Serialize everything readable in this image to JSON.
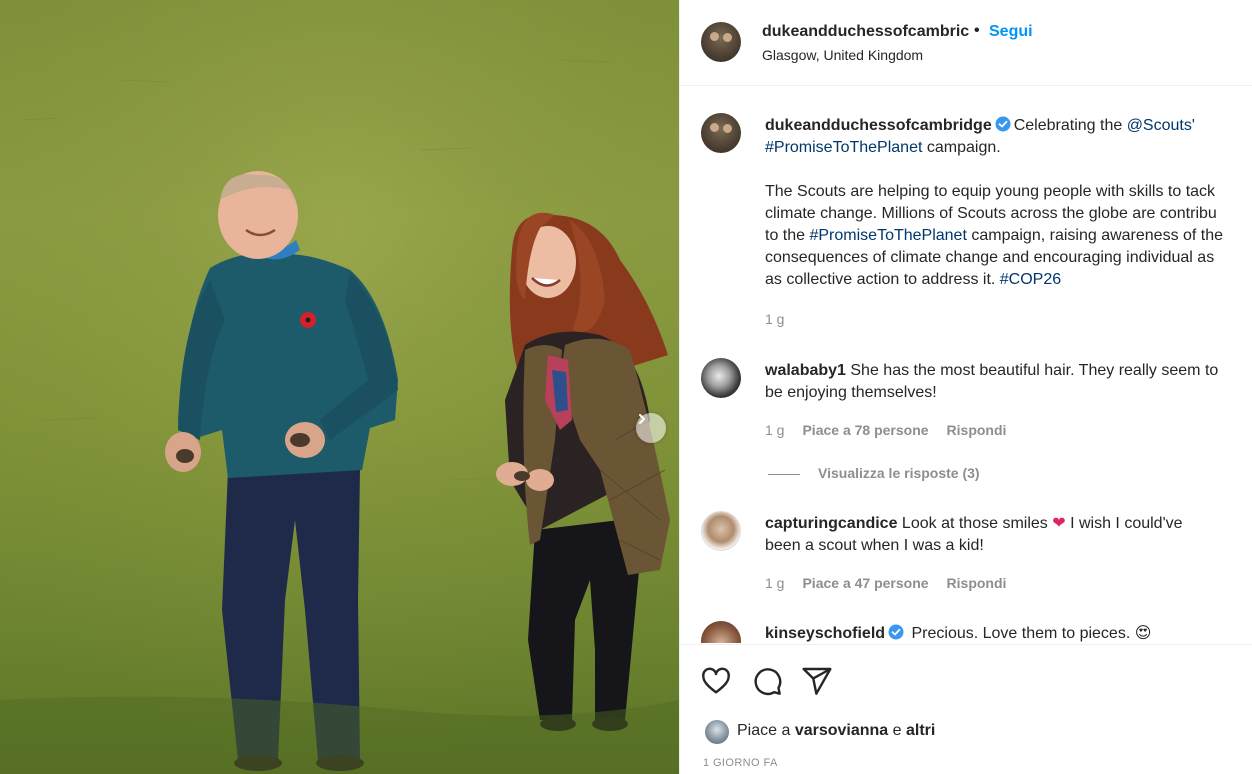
{
  "header": {
    "username": "dukeandduchessofcambric",
    "separator": "•",
    "follow_label": "Segui",
    "location": "Glasgow, United Kingdom"
  },
  "caption": {
    "username": "dukeandduchessofcambridge",
    "text_a": "Celebrating the ",
    "mention": "@Scouts'",
    "hashtag1": "#PromiseToThePlanet",
    "text_b": " campaign.",
    "para_line1": "The Scouts are helping to equip young people with skills to tack",
    "para_line2": "climate change. Millions of Scouts across the globe are contribu",
    "para_line3_a": "to the ",
    "para_line3_tag": "#PromiseToThePlanet",
    "para_line3_b": " campaign, raising awareness of the",
    "para_line4": "consequences of climate change and encouraging individual as",
    "para_line5_a": "as collective action to address it. ",
    "para_line5_tag": "#COP26",
    "time": "1 g"
  },
  "comments": [
    {
      "username": "walababy1",
      "line1": " She has the most beautiful hair. They really seem to",
      "line2": "be enjoying themselves!",
      "time": "1 g",
      "likes": "Piace a 78 persone",
      "reply": "Rispondi",
      "view_replies": "Visualizza le risposte (3)"
    },
    {
      "username": "capturingcandice",
      "line1_a": " Look at those smiles ",
      "emoji": "❤",
      "line1_b": " I wish I could've",
      "line2": "been a scout when I was a kid!",
      "time": "1 g",
      "likes": "Piace a 47 persone",
      "reply": "Rispondi"
    },
    {
      "username": "kinseyschofield",
      "text": " Precious. Love them to pieces. ",
      "emoji": "😍"
    }
  ],
  "actions": {
    "like_icon": "heart-icon",
    "comment_icon": "comment-icon",
    "share_icon": "share-icon"
  },
  "likes": {
    "prefix": "Piace a ",
    "user": "varsovianna",
    "middle": " e ",
    "others": "altri"
  },
  "date": "1 GIORNO FA",
  "colors": {
    "link": "#00376b",
    "follow": "#0095f6",
    "secondary": "#8e8e8e",
    "verified": "#3897f0"
  }
}
